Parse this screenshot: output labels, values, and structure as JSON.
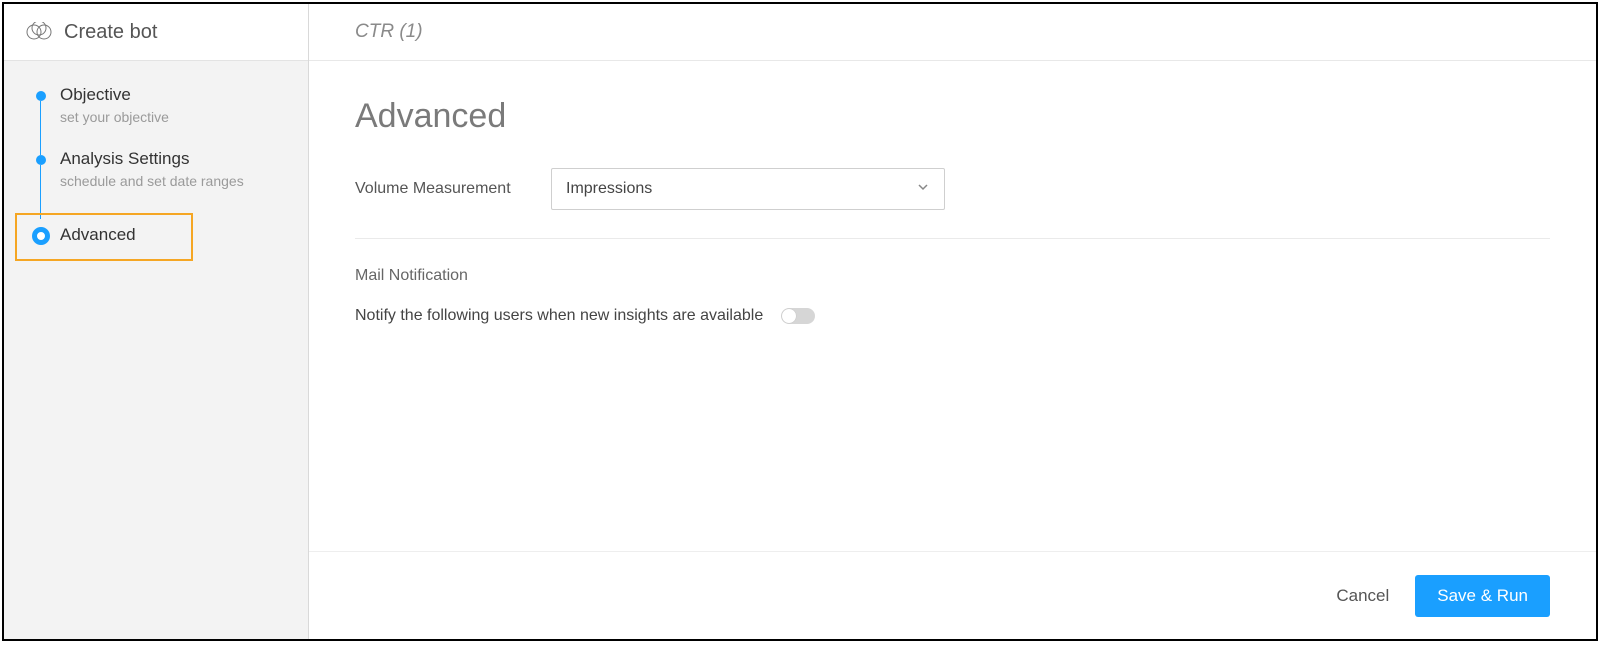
{
  "sidebar": {
    "title": "Create bot",
    "steps": [
      {
        "title": "Objective",
        "sub": "set your objective"
      },
      {
        "title": "Analysis Settings",
        "sub": "schedule and set date ranges"
      },
      {
        "title": "Advanced",
        "sub": ""
      }
    ]
  },
  "header": {
    "breadcrumb": "CTR (1)"
  },
  "page": {
    "title": "Advanced",
    "volume_label": "Volume Measurement",
    "volume_value": "Impressions",
    "mail_section": "Mail Notification",
    "notify_text": "Notify the following users when new insights are available"
  },
  "footer": {
    "cancel": "Cancel",
    "save": "Save & Run"
  }
}
